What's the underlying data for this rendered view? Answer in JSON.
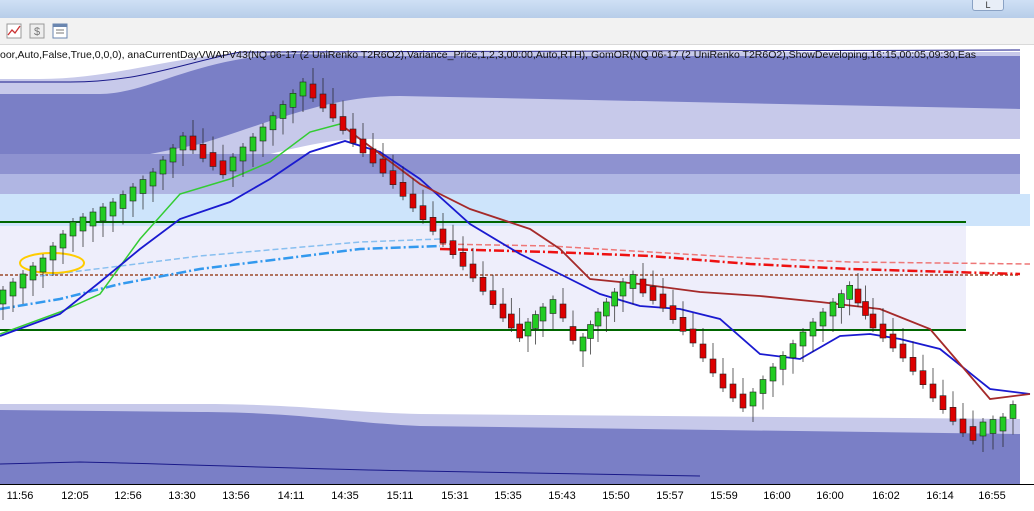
{
  "window": {
    "restore_button_label": "L"
  },
  "toolbar": {
    "buttons": [
      "chart-icon",
      "dollar-icon",
      "properties-icon"
    ]
  },
  "indicator_text": "oor,Auto,False,True,0,0,0), anaCurrentDayVWAPV43(NQ 06-17 (2 UniRenko T2R6O2),Variance_Price,1,2,3,00:00,Auto,RTH), GomOR(NQ 06-17 (2 UniRenko T2R6O2),ShowDeveloping,16:15,00:05,09:30,Eas",
  "x_axis_labels": [
    "11:56",
    "12:05",
    "12:56",
    "13:30",
    "13:56",
    "14:11",
    "14:35",
    "15:11",
    "15:31",
    "15:35",
    "15:43",
    "15:50",
    "15:57",
    "15:59",
    "16:00",
    "16:00",
    "16:02",
    "16:14",
    "16:55"
  ],
  "colors": {
    "up_candle": "#22cc22",
    "down_candle": "#dd0000",
    "blue_ma": "#1a1ad0",
    "brown_ma": "#a52a2a",
    "green_ma": "#33cc33",
    "vwap_blue": "#3399ee",
    "vwap_red": "#ee1111",
    "band_dark": "#7a7fc6",
    "band_light": "#c7c9ea",
    "range_blue": "#cde4fb",
    "or_line": "#006600"
  }
}
